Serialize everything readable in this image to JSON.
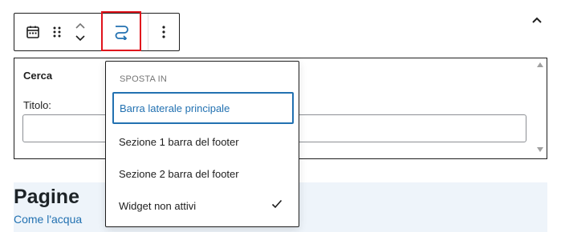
{
  "toolbar": {
    "icons": [
      "calendar-icon",
      "drag-handle-icon",
      "chevron-up-icon",
      "chevron-down-icon",
      "move-to-icon",
      "more-vertical-icon"
    ],
    "highlight_color": "#e0131c",
    "move_icon_color": "#2271b1"
  },
  "widget": {
    "title": "Cerca",
    "field_label": "Titolo:",
    "field_value": ""
  },
  "dropdown": {
    "heading": "SPOSTA IN",
    "items": [
      {
        "label": "Barra laterale principale",
        "active": true,
        "checked": false
      },
      {
        "label": "Sezione 1 barra del footer",
        "active": false,
        "checked": false
      },
      {
        "label": "Sezione 2 barra del footer",
        "active": false,
        "checked": false
      },
      {
        "label": "Widget non attivi",
        "active": false,
        "checked": true
      }
    ]
  },
  "pages": {
    "title": "Pagine",
    "link": "Come l'acqua"
  },
  "colors": {
    "accent": "#2271b1",
    "pages_background": "#eef4fa"
  }
}
